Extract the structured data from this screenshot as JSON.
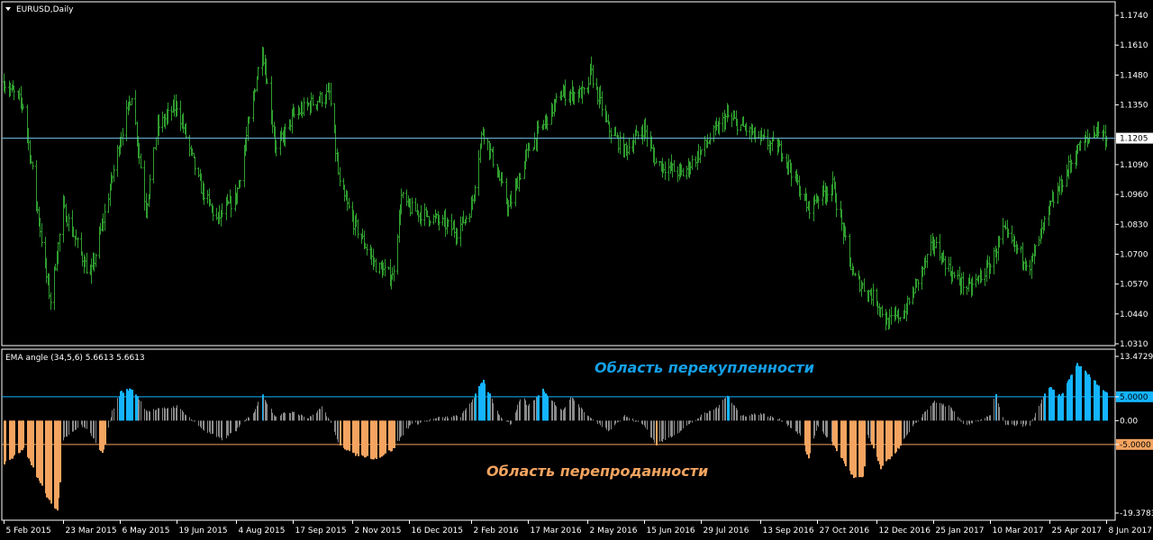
{
  "window": {
    "symbol_title": "EURUSD,Daily",
    "indicator_title": "EMA angle (34,5,6) 5.6613 5.6613"
  },
  "annotations": {
    "overbought": "Область перекупленности",
    "oversold": "Область перепроданности"
  },
  "colors": {
    "background": "#000000",
    "price_bars": "#2f9e2f",
    "overbought": "#14b4ff",
    "oversold": "#f4a460",
    "neutral": "#8c8c8c",
    "current_line": "#6ab8d8",
    "frame": "#ffffff"
  },
  "chart_data": [
    {
      "type": "ohlc",
      "title": "EURUSD,Daily",
      "current_price": 1.1205,
      "current_price_label": "1.1205",
      "ylim": [
        1.031,
        1.174
      ],
      "yticks": [
        "1.1740",
        "1.1610",
        "1.1480",
        "1.1350",
        "1.1090",
        "1.0960",
        "1.0830",
        "1.0700",
        "1.0570",
        "1.0440",
        "1.0310"
      ],
      "ytick_values": [
        1.174,
        1.161,
        1.148,
        1.135,
        1.109,
        1.096,
        1.083,
        1.07,
        1.057,
        1.044,
        1.031
      ],
      "xticks": [
        "5 Feb 2015",
        "23 Mar 2015",
        "6 May 2015",
        "19 Jun 2015",
        "4 Aug 2015",
        "17 Sep 2015",
        "2 Nov 2015",
        "16 Dec 2015",
        "2 Feb 2016",
        "17 Mar 2016",
        "2 May 2016",
        "15 Jun 2016",
        "29 Jul 2016",
        "13 Sep 2016",
        "27 Oct 2016",
        "12 Dec 2016",
        "25 Jan 2017",
        "10 Mar 2017",
        "25 Apr 2017",
        "8 Jun 2017"
      ],
      "close_path": [
        {
          "date": "5 Feb 2015",
          "close": 1.145
        },
        {
          "date": "20 Feb 2015",
          "close": 1.135
        },
        {
          "date": "10 Mar 2015",
          "close": 1.06
        },
        {
          "date": "13 Mar 2015",
          "close": 1.05
        },
        {
          "date": "23 Mar 2015",
          "close": 1.09
        },
        {
          "date": "13 Apr 2015",
          "close": 1.06
        },
        {
          "date": "23 Apr 2015",
          "close": 1.085
        },
        {
          "date": "6 May 2015",
          "close": 1.12
        },
        {
          "date": "15 May 2015",
          "close": 1.14
        },
        {
          "date": "26 May 2015",
          "close": 1.09
        },
        {
          "date": "4 Jun 2015",
          "close": 1.125
        },
        {
          "date": "19 Jun 2015",
          "close": 1.135
        },
        {
          "date": "7 Jul 2015",
          "close": 1.1
        },
        {
          "date": "20 Jul 2015",
          "close": 1.085
        },
        {
          "date": "4 Aug 2015",
          "close": 1.095
        },
        {
          "date": "24 Aug 2015",
          "close": 1.16
        },
        {
          "date": "4 Sep 2015",
          "close": 1.115
        },
        {
          "date": "17 Sep 2015",
          "close": 1.13
        },
        {
          "date": "29 Sep 2015",
          "close": 1.135
        },
        {
          "date": "15 Oct 2015",
          "close": 1.14
        },
        {
          "date": "23 Oct 2015",
          "close": 1.1
        },
        {
          "date": "2 Nov 2015",
          "close": 1.085
        },
        {
          "date": "20 Nov 2015",
          "close": 1.065
        },
        {
          "date": "3 Dec 2015",
          "close": 1.06
        },
        {
          "date": "10 Dec 2015",
          "close": 1.095
        },
        {
          "date": "16 Dec 2015",
          "close": 1.09
        },
        {
          "date": "6 Jan 2016",
          "close": 1.085
        },
        {
          "date": "22 Jan 2016",
          "close": 1.08
        },
        {
          "date": "2 Feb 2016",
          "close": 1.09
        },
        {
          "date": "11 Feb 2016",
          "close": 1.125
        },
        {
          "date": "2 Mar 2016",
          "close": 1.09
        },
        {
          "date": "17 Mar 2016",
          "close": 1.115
        },
        {
          "date": "12 Apr 2016",
          "close": 1.14
        },
        {
          "date": "2 May 2016",
          "close": 1.14
        },
        {
          "date": "4 May 2016",
          "close": 1.15
        },
        {
          "date": "18 May 2016",
          "close": 1.125
        },
        {
          "date": "31 May 2016",
          "close": 1.115
        },
        {
          "date": "15 Jun 2016",
          "close": 1.125
        },
        {
          "date": "24 Jun 2016",
          "close": 1.11
        },
        {
          "date": "15 Jul 2016",
          "close": 1.105
        },
        {
          "date": "29 Jul 2016",
          "close": 1.115
        },
        {
          "date": "18 Aug 2016",
          "close": 1.13
        },
        {
          "date": "13 Sep 2016",
          "close": 1.12
        },
        {
          "date": "30 Sep 2016",
          "close": 1.115
        },
        {
          "date": "20 Oct 2016",
          "close": 1.09
        },
        {
          "date": "27 Oct 2016",
          "close": 1.095
        },
        {
          "date": "8 Nov 2016",
          "close": 1.1
        },
        {
          "date": "24 Nov 2016",
          "close": 1.06
        },
        {
          "date": "12 Dec 2016",
          "close": 1.05
        },
        {
          "date": "20 Dec 2016",
          "close": 1.04
        },
        {
          "date": "3 Jan 2017",
          "close": 1.045
        },
        {
          "date": "25 Jan 2017",
          "close": 1.075
        },
        {
          "date": "10 Feb 2017",
          "close": 1.06
        },
        {
          "date": "22 Feb 2017",
          "close": 1.055
        },
        {
          "date": "10 Mar 2017",
          "close": 1.065
        },
        {
          "date": "20 Mar 2017",
          "close": 1.08
        },
        {
          "date": "10 Apr 2017",
          "close": 1.065
        },
        {
          "date": "25 Apr 2017",
          "close": 1.09
        },
        {
          "date": "16 May 2017",
          "close": 1.115
        },
        {
          "date": "1 Jun 2017",
          "close": 1.125
        },
        {
          "date": "8 Jun 2017",
          "close": 1.1205
        }
      ]
    },
    {
      "type": "histogram",
      "title": "EMA angle (34,5,6) 5.6613 5.6613",
      "ylim": [
        -19.3783,
        13.4729
      ],
      "yticks": [
        "13.4729",
        "5.0000",
        "0.00",
        "-5.0000",
        "-19.3783"
      ],
      "ytick_values": [
        13.4729,
        5.0,
        0.0,
        -5.0,
        -19.3783
      ],
      "thresholds": {
        "upper": 5.0,
        "lower": -5.0
      },
      "last_value": 5.6613,
      "profile": [
        {
          "date": "5 Feb 2015",
          "value": -9
        },
        {
          "date": "20 Feb 2015",
          "value": -6
        },
        {
          "date": "10 Mar 2015",
          "value": -16
        },
        {
          "date": "18 Mar 2015",
          "value": -19
        },
        {
          "date": "23 Mar 2015",
          "value": -4
        },
        {
          "date": "6 Apr 2015",
          "value": -1
        },
        {
          "date": "14 Apr 2015",
          "value": -3
        },
        {
          "date": "22 Apr 2015",
          "value": -7
        },
        {
          "date": "30 Apr 2015",
          "value": 2
        },
        {
          "date": "6 May 2015",
          "value": 6
        },
        {
          "date": "15 May 2015",
          "value": 6.7
        },
        {
          "date": "27 May 2015",
          "value": 2
        },
        {
          "date": "19 Jun 2015",
          "value": 3
        },
        {
          "date": "10 Jul 2015",
          "value": -2
        },
        {
          "date": "24 Jul 2015",
          "value": -4
        },
        {
          "date": "4 Aug 2015",
          "value": -2
        },
        {
          "date": "18 Aug 2015",
          "value": 2
        },
        {
          "date": "24 Aug 2015",
          "value": 5.5
        },
        {
          "date": "3 Sep 2015",
          "value": 1
        },
        {
          "date": "17 Sep 2015",
          "value": 2
        },
        {
          "date": "29 Sep 2015",
          "value": 0.5
        },
        {
          "date": "10 Oct 2015",
          "value": 3
        },
        {
          "date": "23 Oct 2015",
          "value": -5
        },
        {
          "date": "2 Nov 2015",
          "value": -7
        },
        {
          "date": "20 Nov 2015",
          "value": -8
        },
        {
          "date": "3 Dec 2015",
          "value": -6
        },
        {
          "date": "16 Dec 2015",
          "value": -1
        },
        {
          "date": "6 Jan 2016",
          "value": 0.5
        },
        {
          "date": "25 Jan 2016",
          "value": 1
        },
        {
          "date": "2 Feb 2016",
          "value": 4
        },
        {
          "date": "11 Feb 2016",
          "value": 8.5
        },
        {
          "date": "24 Feb 2016",
          "value": 1
        },
        {
          "date": "4 Mar 2016",
          "value": -1
        },
        {
          "date": "12 Mar 2016",
          "value": 5.5
        },
        {
          "date": "17 Mar 2016",
          "value": 3
        },
        {
          "date": "28 Mar 2016",
          "value": 6.5
        },
        {
          "date": "12 Apr 2016",
          "value": 2
        },
        {
          "date": "20 Apr 2016",
          "value": 5
        },
        {
          "date": "2 May 2016",
          "value": 1
        },
        {
          "date": "18 May 2016",
          "value": -2
        },
        {
          "date": "31 May 2016",
          "value": 1
        },
        {
          "date": "15 Jun 2016",
          "value": -1
        },
        {
          "date": "24 Jun 2016",
          "value": -5
        },
        {
          "date": "8 Jul 2016",
          "value": -3
        },
        {
          "date": "29 Jul 2016",
          "value": 1
        },
        {
          "date": "12 Aug 2016",
          "value": 3
        },
        {
          "date": "18 Aug 2016",
          "value": 5.5
        },
        {
          "date": "29 Aug 2016",
          "value": 1
        },
        {
          "date": "13 Sep 2016",
          "value": 1.5
        },
        {
          "date": "30 Sep 2016",
          "value": 0
        },
        {
          "date": "14 Oct 2016",
          "value": -3
        },
        {
          "date": "20 Oct 2016",
          "value": -8
        },
        {
          "date": "27 Oct 2016",
          "value": -1
        },
        {
          "date": "8 Nov 2016",
          "value": -5
        },
        {
          "date": "24 Nov 2016",
          "value": -12
        },
        {
          "date": "1 Dec 2016",
          "value": -12
        },
        {
          "date": "5 Dec 2016",
          "value": -3
        },
        {
          "date": "15 Dec 2016",
          "value": -10
        },
        {
          "date": "28 Dec 2016",
          "value": -6
        },
        {
          "date": "10 Jan 2017",
          "value": -1
        },
        {
          "date": "25 Jan 2017",
          "value": 4
        },
        {
          "date": "6 Feb 2017",
          "value": 3
        },
        {
          "date": "18 Feb 2017",
          "value": -1
        },
        {
          "date": "10 Mar 2017",
          "value": 1
        },
        {
          "date": "14 Mar 2017",
          "value": 5.5
        },
        {
          "date": "22 Mar 2017",
          "value": -1
        },
        {
          "date": "10 Apr 2017",
          "value": -1
        },
        {
          "date": "20 Apr 2017",
          "value": 5
        },
        {
          "date": "25 Apr 2017",
          "value": 7
        },
        {
          "date": "3 May 2017",
          "value": 5
        },
        {
          "date": "16 May 2017",
          "value": 12
        },
        {
          "date": "25 May 2017",
          "value": 9.5
        },
        {
          "date": "8 Jun 2017",
          "value": 5.6613
        }
      ]
    }
  ]
}
